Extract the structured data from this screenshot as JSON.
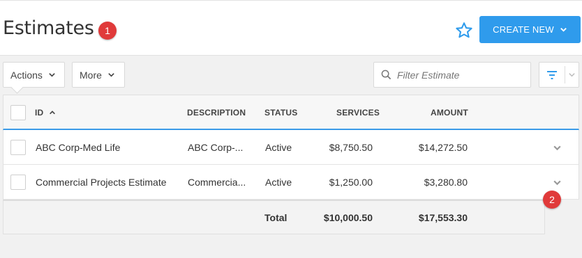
{
  "header": {
    "title": "Estimates",
    "badge_1": "1",
    "create_label": "CREATE NEW"
  },
  "toolbar": {
    "actions_label": "Actions",
    "more_label": "More",
    "filter_placeholder": "Filter Estimate"
  },
  "table": {
    "columns": {
      "id": "ID",
      "description": "DESCRIPTION",
      "status": "STATUS",
      "services": "SERVICES",
      "amount": "AMOUNT"
    },
    "rows": [
      {
        "id": "ABC Corp-Med Life",
        "description": "ABC Corp-...",
        "status": "Active",
        "services": "$8,750.50",
        "amount": "$14,272.50"
      },
      {
        "id": "Commercial Projects Estimate",
        "description": "Commercia...",
        "status": "Active",
        "services": "$1,250.00",
        "amount": "$3,280.80"
      }
    ],
    "footer": {
      "label": "Total",
      "services": "$10,000.50",
      "amount": "$17,553.30"
    }
  },
  "badge_2": "2",
  "colors": {
    "accent": "#2f9bec",
    "badge": "#e03a3a"
  },
  "icons": [
    "star-icon",
    "chevron-down-icon",
    "search-icon",
    "filter-icon",
    "sort-asc-icon"
  ]
}
